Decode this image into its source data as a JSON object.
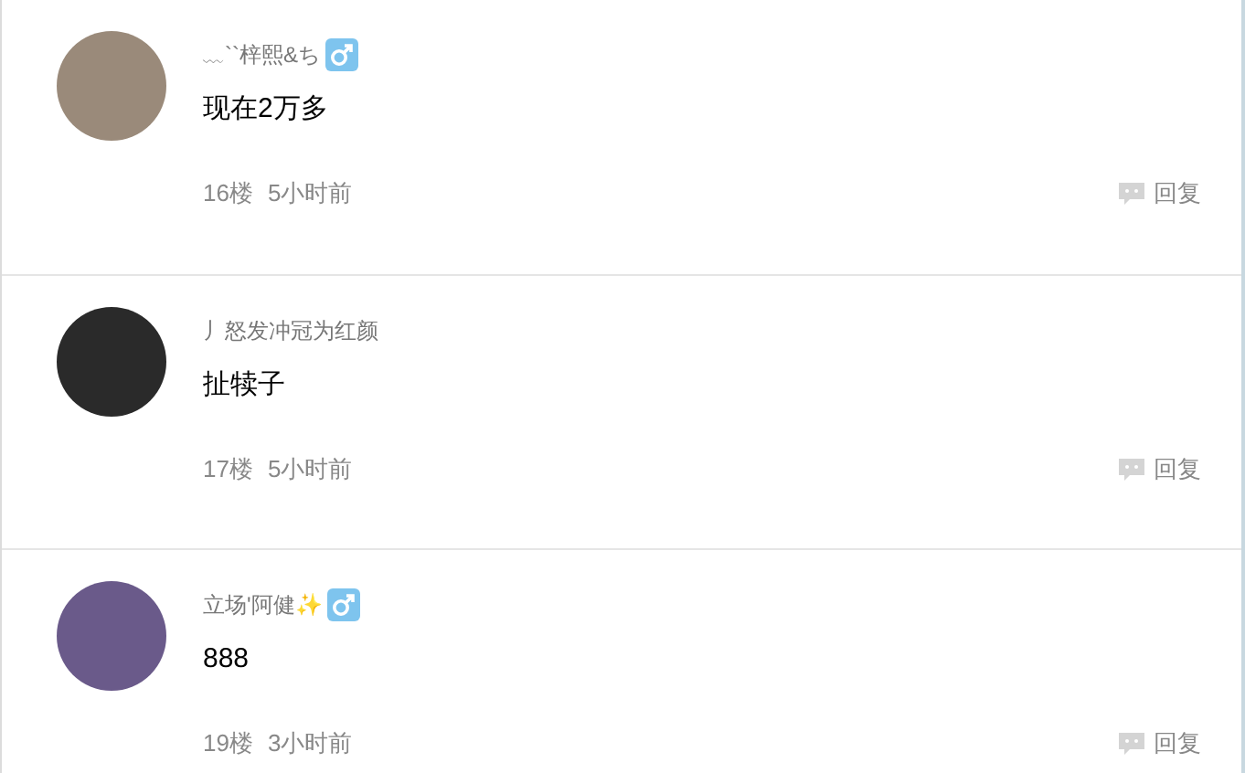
{
  "comments": [
    {
      "username": "﹏``梓熙&ち",
      "male_badge": true,
      "content": "现在2万多",
      "floor": "16楼",
      "time": "5小时前",
      "reply": "回复"
    },
    {
      "username": "丿怒发冲冠为红颜",
      "male_badge": false,
      "content": "扯犊子",
      "floor": "17楼",
      "time": "5小时前",
      "reply": "回复"
    },
    {
      "username": "立场'阿健✨",
      "male_badge": true,
      "content": "888",
      "floor": "19楼",
      "time": "3小时前",
      "reply": "回复"
    }
  ]
}
